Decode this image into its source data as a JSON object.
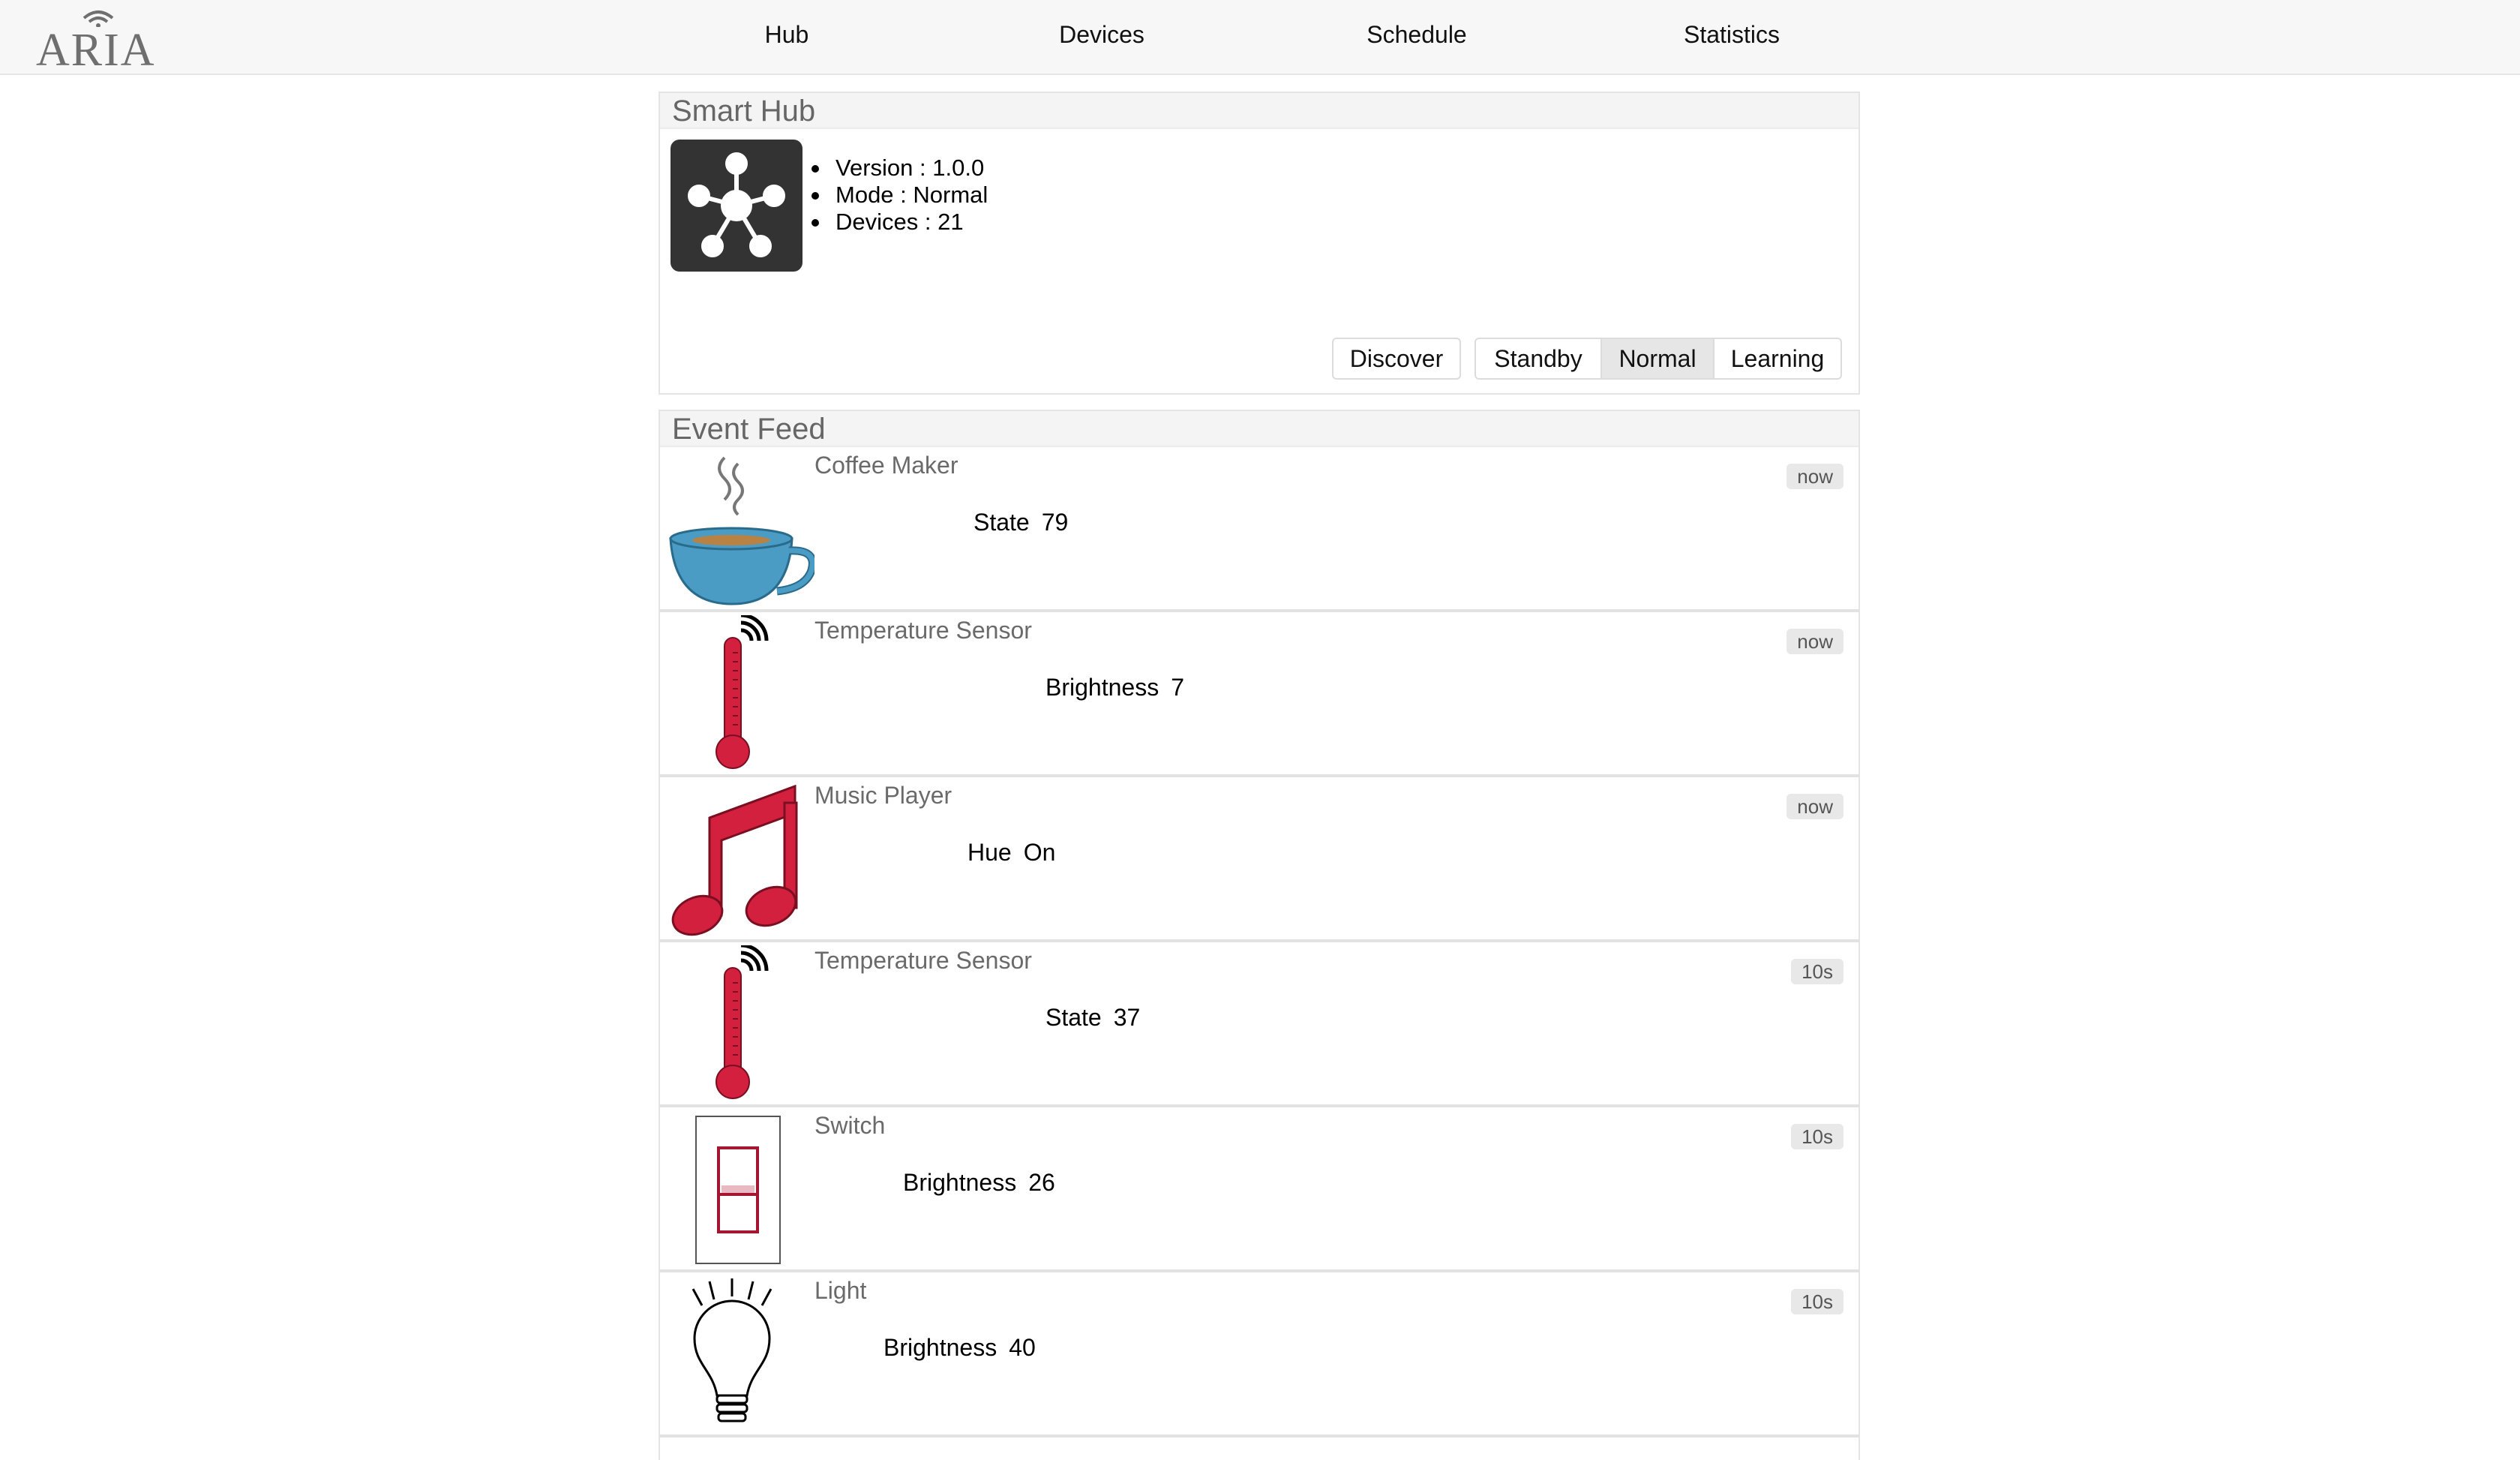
{
  "app": {
    "logo_text": "ARIA"
  },
  "nav": {
    "items": [
      "Hub",
      "Devices",
      "Schedule",
      "Statistics"
    ]
  },
  "hub": {
    "title": "Smart Hub",
    "info": [
      "Version : 1.0.0",
      "Mode : Normal",
      "Devices : 21"
    ],
    "discover_label": "Discover",
    "modes": [
      "Standby",
      "Normal",
      "Learning"
    ],
    "active_mode": "Normal"
  },
  "feed": {
    "title": "Event Feed",
    "events": [
      {
        "device": "Coffee Maker",
        "icon": "coffee-icon",
        "property": "State",
        "value": "79",
        "time": "now"
      },
      {
        "device": "Temperature Sensor",
        "icon": "thermometer-icon",
        "property": "Brightness",
        "value": "7",
        "time": "now"
      },
      {
        "device": "Music Player",
        "icon": "music-note-icon",
        "property": "Hue",
        "value": "On",
        "time": "now"
      },
      {
        "device": "Temperature Sensor",
        "icon": "thermometer-icon",
        "property": "State",
        "value": "37",
        "time": "10s"
      },
      {
        "device": "Switch",
        "icon": "switch-icon",
        "property": "Brightness",
        "value": "26",
        "time": "10s"
      },
      {
        "device": "Light",
        "icon": "light-bulb-icon",
        "property": "Brightness",
        "value": "40",
        "time": "10s"
      }
    ]
  },
  "colors": {
    "accent_red": "#d2203e",
    "cup_blue": "#4a9cc4",
    "hub_icon_bg": "#333333"
  }
}
